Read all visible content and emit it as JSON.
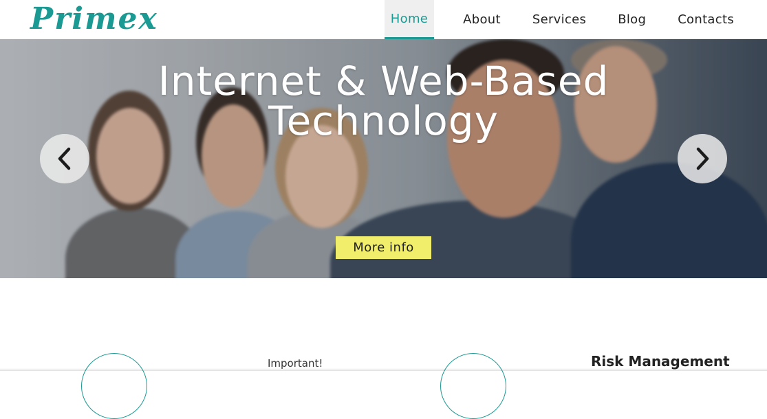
{
  "brand": {
    "logo": "Primex",
    "accent": "#1a9a93"
  },
  "nav": {
    "items": [
      {
        "label": "Home",
        "active": true
      },
      {
        "label": "About",
        "active": false
      },
      {
        "label": "Services",
        "active": false
      },
      {
        "label": "Blog",
        "active": false
      },
      {
        "label": "Contacts",
        "active": false
      }
    ]
  },
  "hero": {
    "title_line1": "Internet & Web-Based",
    "title_line2": "Technology",
    "button_label": "More info",
    "button_color": "#f0ee6a",
    "prev_icon": "chevron-left-icon",
    "next_icon": "chevron-right-icon"
  },
  "features": {
    "important_label": "Important!",
    "risk_title": "Risk Management"
  }
}
